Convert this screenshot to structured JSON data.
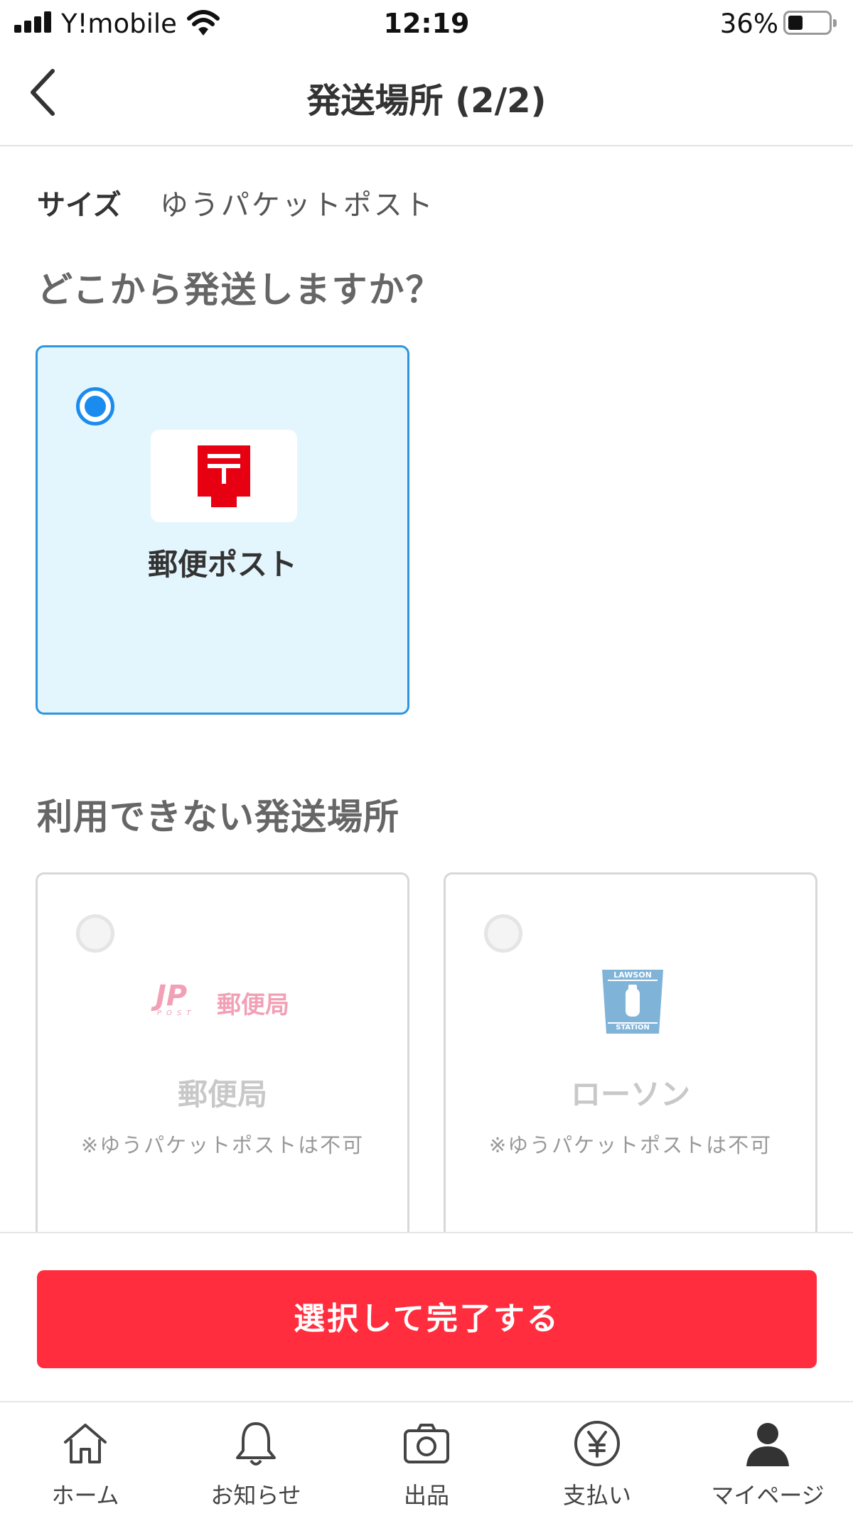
{
  "status_bar": {
    "carrier": "Y!mobile",
    "time": "12:19",
    "battery_percent": "36%",
    "battery_level": 0.36
  },
  "header": {
    "title": "発送場所 (2/2)"
  },
  "size": {
    "label": "サイズ",
    "value": "ゆうパケットポスト"
  },
  "question": "どこから発送しますか？",
  "available_options": [
    {
      "label": "郵便ポスト",
      "selected": true
    }
  ],
  "unavailable_section": {
    "title": "利用できない発送場所",
    "options": [
      {
        "logo_text": "郵便局",
        "logo_mark": "JP",
        "logo_sub": "POST",
        "label": "郵便局",
        "note": "※ゆうパケットポストは不可"
      },
      {
        "logo_top": "LAWSON",
        "logo_bottom": "STATION",
        "label": "ローソン",
        "note": "※ゆうパケットポストは不可"
      }
    ]
  },
  "submit_button": "選択して完了する",
  "tab_bar": [
    {
      "label": "ホーム",
      "icon": "home-icon"
    },
    {
      "label": "お知らせ",
      "icon": "bell-icon"
    },
    {
      "label": "出品",
      "icon": "camera-icon"
    },
    {
      "label": "支払い",
      "icon": "yen-icon"
    },
    {
      "label": "マイページ",
      "icon": "person-icon"
    }
  ],
  "colors": {
    "accent_red": "#ff2d3d",
    "selected_blue": "#1a8cf0",
    "selected_bg": "#e4f6fd",
    "post_red": "#e60012",
    "jp_pink": "#f2a0b5",
    "lawson_blue": "#7fb3d8"
  }
}
